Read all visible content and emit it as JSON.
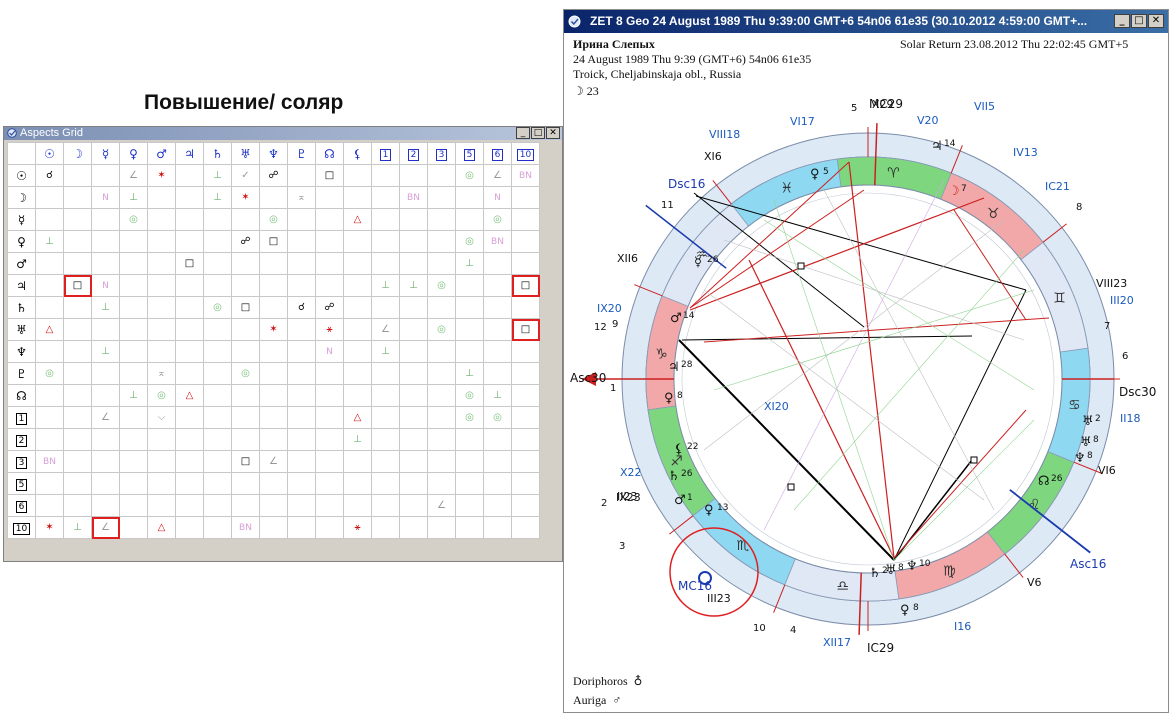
{
  "heading": "Повышение/ соляр",
  "aspects_window": {
    "title": "Aspects Grid",
    "buttons": [
      "_",
      "□",
      "✕"
    ],
    "columns": [
      "☉",
      "☽",
      "☿",
      "♀",
      "♂",
      "♃",
      "♄",
      "♅",
      "♆",
      "♇",
      "☊",
      "⚸",
      "1",
      "2",
      "3",
      "5",
      "6",
      "10"
    ],
    "rows": [
      {
        "label": "☉",
        "cells": [
          "☌",
          "",
          "",
          "∠",
          "✶",
          "",
          "⊥",
          "✓",
          "☍",
          "",
          "□",
          "",
          "",
          "",
          "",
          "◎",
          "∠",
          "BN"
        ]
      },
      {
        "label": "☽",
        "cells": [
          "",
          "",
          "N",
          "⊥",
          "",
          "",
          "⊥",
          "✶",
          "",
          "⌅",
          "",
          "",
          "",
          "BN",
          "",
          "",
          "N",
          ""
        ]
      },
      {
        "label": "☿",
        "cells": [
          "",
          "",
          "",
          "◎",
          "",
          "",
          "",
          "",
          "◎",
          "",
          "",
          "△",
          "",
          "",
          "",
          "",
          "◎",
          ""
        ]
      },
      {
        "label": "♀",
        "cells": [
          "⊥",
          "",
          "",
          "",
          "",
          "",
          "",
          "☍",
          "□",
          "",
          "",
          "",
          "",
          "",
          "",
          "◎",
          "BN",
          ""
        ]
      },
      {
        "label": "♂",
        "cells": [
          "",
          "",
          "",
          "",
          "",
          "□",
          "",
          "",
          "",
          "",
          "",
          "",
          "",
          "",
          "",
          "⊥",
          "",
          ""
        ]
      },
      {
        "label": "♃",
        "cells": [
          "",
          "□",
          "N",
          "",
          "",
          "",
          "",
          "",
          "",
          "",
          "",
          "",
          "⊥",
          "⊥",
          "◎",
          "",
          "",
          "□"
        ]
      },
      {
        "label": "♄",
        "cells": [
          "",
          "",
          "⊥",
          "",
          "",
          "",
          "◎",
          "□",
          "",
          "☌",
          "☍",
          "",
          "",
          "",
          "",
          "",
          "",
          ""
        ]
      },
      {
        "label": "♅",
        "cells": [
          "△",
          "",
          "",
          "",
          "",
          "",
          "",
          "",
          "✶",
          "",
          "⚹",
          "",
          "∠",
          "",
          "◎",
          "",
          "",
          "□"
        ]
      },
      {
        "label": "♆",
        "cells": [
          "",
          "",
          "⊥",
          "",
          "",
          "",
          "",
          "",
          "",
          "",
          "N",
          "",
          "⊥",
          "",
          "",
          "",
          "",
          ""
        ]
      },
      {
        "label": "♇",
        "cells": [
          "◎",
          "",
          "",
          "",
          "⌅",
          "",
          "",
          "◎",
          "",
          "",
          "",
          "",
          "",
          "",
          "",
          "⊥",
          "",
          ""
        ]
      },
      {
        "label": "☊",
        "cells": [
          "",
          "",
          "",
          "⊥",
          "◎",
          "△",
          "",
          "",
          "",
          "",
          "",
          "",
          "",
          "",
          "",
          "◎",
          "⊥",
          ""
        ]
      },
      {
        "label": "1",
        "cells": [
          "",
          "",
          "∠",
          "",
          "⌵",
          "",
          "",
          "",
          "",
          "",
          "",
          "△",
          "",
          "",
          "",
          "◎",
          "◎",
          ""
        ]
      },
      {
        "label": "2",
        "cells": [
          "",
          "",
          "",
          "",
          "",
          "",
          "",
          "",
          "",
          "",
          "",
          "⊥",
          "",
          "",
          "",
          "",
          "",
          ""
        ]
      },
      {
        "label": "3",
        "cells": [
          "BN",
          "",
          "",
          "",
          "",
          "",
          "",
          "□",
          "∠",
          "",
          "",
          "",
          "",
          "",
          "",
          "",
          "",
          ""
        ]
      },
      {
        "label": "5",
        "cells": [
          "",
          "",
          "",
          "",
          "",
          "",
          "",
          "",
          "",
          "",
          "",
          "",
          "",
          "",
          "",
          "",
          "",
          ""
        ]
      },
      {
        "label": "6",
        "cells": [
          "",
          "",
          "",
          "",
          "",
          "",
          "",
          "",
          "",
          "",
          "",
          "",
          "",
          "",
          "∠",
          "",
          "",
          ""
        ]
      },
      {
        "label": "10",
        "cells": [
          "✶",
          "⊥",
          "∠",
          "",
          "△",
          "",
          "",
          "BN",
          "",
          "",
          "",
          "⚹",
          "",
          "",
          "",
          "",
          "",
          ""
        ]
      }
    ]
  },
  "chart_window": {
    "title": "ZET 8 Geo   24 August 1989  Thu   9:39:00 GMT+6 54n06  61e35  (30.10.2012  4:59:00 GMT+...",
    "buttons": [
      "_",
      "□",
      "✕"
    ],
    "name": "Ирина Слепых",
    "birth": "24 August 1989  Thu   9:39 (GMT+6) 54n06  61e35",
    "place": "Troick, Cheljabinskaja obl., Russia",
    "moon_line": "☽  23",
    "solar_return": "Solar Return 23.08.2012  Thu 22:02:45 GMT+5",
    "footer": [
      {
        "name": "Doriphoros",
        "glyph": "♁"
      },
      {
        "name": "Auriga",
        "glyph": "♂"
      }
    ]
  },
  "wheel": {
    "zodiac": [
      "♑",
      "♐",
      "♏",
      "♎",
      "♍",
      "♌",
      "♋",
      "♊",
      "♉",
      "♈",
      "♓",
      "♒"
    ],
    "angle_labels": [
      {
        "text": "Asc30",
        "color": "#111111"
      },
      {
        "text": "Dsc30",
        "color": "#111111"
      },
      {
        "text": "MC29",
        "color": "#111111"
      },
      {
        "text": "IC29",
        "color": "#111111"
      },
      {
        "text": "Dsc16",
        "color": "#1a3ab0"
      },
      {
        "text": "Asc16",
        "color": "#1a3ab0"
      },
      {
        "text": "MC16",
        "color": "#1a3ab0"
      }
    ],
    "roman_outer": [
      {
        "text": "XII6"
      },
      {
        "text": "XI6"
      },
      {
        "text": "X29"
      },
      {
        "text": "IX23"
      },
      {
        "text": "VIII23"
      },
      {
        "text": "VI6"
      },
      {
        "text": "V6"
      },
      {
        "text": "III23"
      },
      {
        "text": "II23"
      }
    ],
    "roman_blue": [
      {
        "text": "VI17"
      },
      {
        "text": "V20"
      },
      {
        "text": "IV13"
      },
      {
        "text": "IC21"
      },
      {
        "text": "III20"
      },
      {
        "text": "II18"
      },
      {
        "text": "I16"
      },
      {
        "text": "XII17"
      },
      {
        "text": "XI20"
      },
      {
        "text": "X22"
      },
      {
        "text": "IX20"
      },
      {
        "text": "VIII18"
      },
      {
        "text": "VII5"
      }
    ],
    "house_numbers": [
      "1",
      "2",
      "3",
      "4",
      "5",
      "6",
      "7",
      "8",
      "9",
      "10",
      "11",
      "12"
    ],
    "planets_inner": [
      {
        "glyph": "☿",
        "deg": "26"
      },
      {
        "glyph": "♂",
        "deg": "14"
      },
      {
        "glyph": "♃",
        "deg": "28"
      },
      {
        "glyph": "♀",
        "deg": "8"
      },
      {
        "glyph": "⚸",
        "deg": "22"
      },
      {
        "glyph": "♄",
        "deg": "26"
      },
      {
        "glyph": "♂",
        "deg": "1"
      },
      {
        "glyph": "♀",
        "deg": "13"
      },
      {
        "glyph": "♄",
        "deg": "2"
      },
      {
        "glyph": "♅",
        "deg": "8"
      },
      {
        "glyph": "♆",
        "deg": "10"
      },
      {
        "glyph": "♀",
        "deg": "8"
      },
      {
        "glyph": "☊",
        "deg": "26"
      },
      {
        "glyph": "♆",
        "deg": "8"
      },
      {
        "glyph": "♅",
        "deg": "2"
      },
      {
        "glyph": "♅",
        "deg": "8"
      },
      {
        "glyph": "☽",
        "deg": "7"
      },
      {
        "glyph": "♃",
        "deg": "14"
      },
      {
        "glyph": "♀",
        "deg": "5"
      }
    ]
  }
}
